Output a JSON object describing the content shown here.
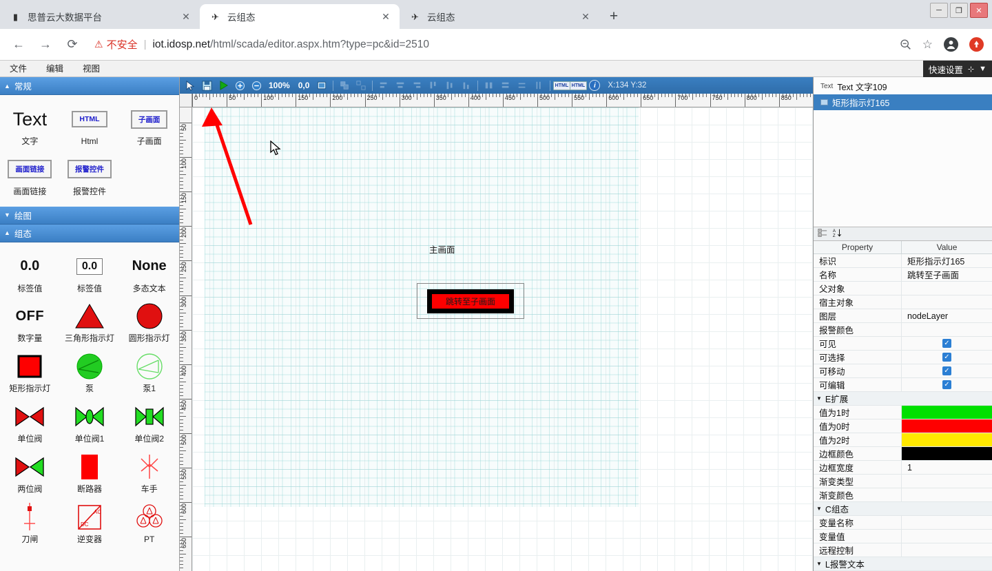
{
  "browser": {
    "tabs": [
      {
        "title": "思普云大数据平台",
        "favicon": "document-icon",
        "active": false
      },
      {
        "title": "云组态",
        "favicon": "app-logo-icon",
        "active": true
      },
      {
        "title": "云组态",
        "favicon": "app-logo-icon",
        "active": false
      }
    ],
    "new_tab_label": "+",
    "close_label": "✕",
    "window_controls": {
      "minimize": "─",
      "restore": "❐",
      "close": "✕"
    },
    "nav": {
      "back": "←",
      "forward": "→",
      "reload": "⟳"
    },
    "security_warning": "不安全",
    "warning_icon": "⚠",
    "url_host": "iot.idosp.net",
    "url_path": "/html/scada/editor.aspx.htm?type=pc&id=2510",
    "actions": {
      "zoom_out": "🔍",
      "bookmark": "☆",
      "profile": "●",
      "extension": "◆"
    }
  },
  "app_menu": {
    "items": [
      "文件",
      "编辑",
      "视图"
    ],
    "quick_settings_label": "快速设置",
    "quick_settings_icons": [
      "grid-icon",
      "chevron-down-icon"
    ]
  },
  "left_panel": {
    "sections": [
      {
        "label": "常规",
        "expanded": true,
        "arrow": "▲"
      },
      {
        "label": "绘图",
        "expanded": false,
        "arrow": "▼"
      },
      {
        "label": "组态",
        "expanded": true,
        "arrow": "▲"
      }
    ],
    "general_items": [
      {
        "label": "文字",
        "glyph": "Text",
        "kind": "text"
      },
      {
        "label": "Html",
        "glyph": "HTML",
        "kind": "chip"
      },
      {
        "label": "子画面",
        "glyph": "子画面",
        "kind": "chip"
      },
      {
        "label": "画面链接",
        "glyph": "画面链接",
        "kind": "chip"
      },
      {
        "label": "报警控件",
        "glyph": "报警控件",
        "kind": "chip"
      }
    ],
    "config_items": [
      {
        "label": "标签值",
        "glyph": "0.0",
        "kind": "numbig"
      },
      {
        "label": "标签值",
        "glyph": "0.0",
        "kind": "numbox"
      },
      {
        "label": "多态文本",
        "glyph": "None",
        "kind": "numbig"
      },
      {
        "label": "数字量",
        "glyph": "OFF",
        "kind": "off"
      },
      {
        "label": "三角形指示灯",
        "glyph": "triangle-indicator-icon",
        "kind": "svg"
      },
      {
        "label": "圆形指示灯",
        "glyph": "circle-indicator-icon",
        "kind": "svg"
      },
      {
        "label": "矩形指示灯",
        "glyph": "rect-indicator-icon",
        "kind": "svg"
      },
      {
        "label": "泵",
        "glyph": "pump-icon",
        "kind": "svg"
      },
      {
        "label": "泵1",
        "glyph": "pump1-icon",
        "kind": "svg"
      },
      {
        "label": "单位阀",
        "glyph": "valve-icon",
        "kind": "svg"
      },
      {
        "label": "单位阀1",
        "glyph": "valve1-icon",
        "kind": "svg"
      },
      {
        "label": "单位阀2",
        "glyph": "valve2-icon",
        "kind": "svg"
      },
      {
        "label": "两位阀",
        "glyph": "two-position-valve-icon",
        "kind": "svg"
      },
      {
        "label": "断路器",
        "glyph": "breaker-icon",
        "kind": "svg"
      },
      {
        "label": "车手",
        "glyph": "handcart-icon",
        "kind": "svg"
      },
      {
        "label": "刀闸",
        "glyph": "disconnector-icon",
        "kind": "svg"
      },
      {
        "label": "逆变器",
        "glyph": "inverter-icon",
        "kind": "svg"
      },
      {
        "label": "PT",
        "glyph": "pt-icon",
        "kind": "svg"
      }
    ]
  },
  "toolbar": {
    "select_tool": "select-arrow-icon",
    "save_tool": "save-disk-icon",
    "run_tool": "play-icon",
    "zoom_in_tool": "zoom-in-icon",
    "zoom_out_tool": "zoom-out-icon",
    "zoom_level": "100%",
    "origin": "0,0",
    "screen_tool": "screen-icon",
    "align_tools": [
      "group-icon",
      "ungroup-icon",
      "align-left-icon",
      "align-center-h-icon",
      "align-right-icon",
      "align-top-icon",
      "align-middle-v-icon",
      "align-bottom-icon",
      "distribute-h-icon",
      "same-width-icon",
      "same-height-icon",
      "same-size-icon"
    ],
    "html_button_1": "HTML",
    "html_button_2": "HTML",
    "info_button": "i",
    "mouse_position": "X:134 Y:32"
  },
  "canvas": {
    "ruler_h_labels": [
      "0",
      "50",
      "100",
      "150",
      "200",
      "250",
      "300",
      "350",
      "400",
      "450",
      "500",
      "550",
      "600",
      "650",
      "700",
      "750",
      "800",
      "850"
    ],
    "ruler_v_labels": [
      "50",
      "100",
      "150",
      "200",
      "250",
      "300",
      "350",
      "400",
      "450",
      "500",
      "550",
      "600",
      "650"
    ],
    "title_text": "主画面",
    "lamp_text": "跳转至子画面",
    "lamp_fill_color": "#fe0000",
    "lamp_border_color": "#000000",
    "selection_border_color": "#888888",
    "annotation_arrow_color": "#ff0000"
  },
  "right_panel": {
    "tree": [
      {
        "label": "Text 文字109",
        "icon": "text-node-icon",
        "selected": false
      },
      {
        "label": "矩形指示灯165",
        "icon": "rect-node-icon",
        "selected": true
      }
    ],
    "prop_toolbar_icons": [
      "categorized-icon",
      "alphabetical-sort-icon"
    ],
    "columns": {
      "property": "Property",
      "value": "Value"
    },
    "rows": [
      {
        "type": "row",
        "key": "标识",
        "value": "矩形指示灯165"
      },
      {
        "type": "row",
        "key": "名称",
        "value": "跳转至子画面"
      },
      {
        "type": "row",
        "key": "父对象",
        "value": ""
      },
      {
        "type": "row",
        "key": "宿主对象",
        "value": ""
      },
      {
        "type": "row",
        "key": "图层",
        "value": "nodeLayer"
      },
      {
        "type": "row",
        "key": "报警颜色",
        "value": ""
      },
      {
        "type": "check",
        "key": "可见",
        "value": "✓"
      },
      {
        "type": "check",
        "key": "可选择",
        "value": "✓"
      },
      {
        "type": "check",
        "key": "可移动",
        "value": "✓"
      },
      {
        "type": "check",
        "key": "可编辑",
        "value": "✓"
      },
      {
        "type": "group",
        "key": "E扩展",
        "arrow": "▼"
      },
      {
        "type": "color",
        "key": "值为1时",
        "value": "#00e000"
      },
      {
        "type": "color",
        "key": "值为0时",
        "value": "#fe0000"
      },
      {
        "type": "color",
        "key": "值为2时",
        "value": "#ffe800"
      },
      {
        "type": "color",
        "key": "边框颜色",
        "value": "#000000"
      },
      {
        "type": "row",
        "key": "边框宽度",
        "value": "1"
      },
      {
        "type": "row",
        "key": "渐变类型",
        "value": ""
      },
      {
        "type": "row",
        "key": "渐变颜色",
        "value": ""
      },
      {
        "type": "group",
        "key": "C组态",
        "arrow": "▼"
      },
      {
        "type": "row",
        "key": "变量名称",
        "value": ""
      },
      {
        "type": "row",
        "key": "变量值",
        "value": ""
      },
      {
        "type": "row",
        "key": "远程控制",
        "value": ""
      },
      {
        "type": "group",
        "key": "L报警文本",
        "arrow": "▼"
      }
    ]
  }
}
